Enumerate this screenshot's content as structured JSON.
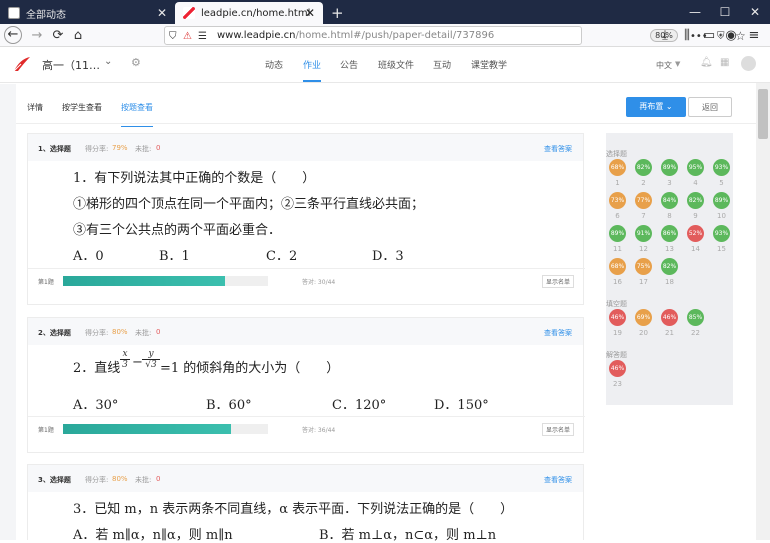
{
  "browser": {
    "tabs": [
      {
        "label": "全部动态",
        "active": false
      },
      {
        "label": "leadpie.cn/home.html#/push",
        "active": true
      }
    ],
    "new_tab": "+",
    "url_domain": "www.leadpie.cn",
    "url_path": "/home.html#/push/paper-detail/737896",
    "zoom": "80%",
    "menu_dots": "•••"
  },
  "app": {
    "class_name": "高一（11…",
    "nav": [
      "动态",
      "作业",
      "公告",
      "班级文件",
      "互动",
      "课堂教学"
    ],
    "active_nav": 1,
    "lang": "中文"
  },
  "subtabs": [
    "详情",
    "按学生查看",
    "按题查看"
  ],
  "active_subtab": 2,
  "buttons": {
    "reassign": "再布置",
    "back": "返回"
  },
  "questions": [
    {
      "head": "1、选择题",
      "score_label": "得分率:",
      "score": "79%",
      "score_color": "#e8a04a",
      "unsub_label": "未批:",
      "unsub": "0",
      "answer_link": "查看答案",
      "lines": [
        "1．有下列说法其中正确的个数是（　　）",
        "①梯形的四个顶点在同一个平面内；②三条平行直线必共面；",
        "③有三个公共点的两个平面必重合．"
      ],
      "options": [
        "A．0",
        "B．1",
        "C．2",
        "D．3"
      ],
      "bar_label": "第1题",
      "progress": 0.79,
      "correct": "答对: 30/44",
      "show_names": "显示名单"
    },
    {
      "head": "2、选择题",
      "score_label": "得分率:",
      "score": "80%",
      "score_color": "#e8a04a",
      "unsub_label": "未批:",
      "unsub": "0",
      "answer_link": "查看答案",
      "lines": [
        "2．直线",
        "=1 的倾斜角的大小为（　　）"
      ],
      "frac1": {
        "num": "x",
        "den": "3"
      },
      "frac2": {
        "num": "y",
        "den": "√3"
      },
      "options": [
        "A．30°",
        "B．60°",
        "C．120°",
        "D．150°"
      ],
      "bar_label": "第1题",
      "progress": 0.82,
      "correct": "答对: 36/44",
      "show_names": "显示名单"
    },
    {
      "head": "3、选择题",
      "score_label": "得分率:",
      "score": "80%",
      "score_color": "#e8a04a",
      "unsub_label": "未批:",
      "unsub": "0",
      "answer_link": "查看答案",
      "lines": [
        "3．已知 m，n 表示两条不同直线，α 表示平面．下列说法正确的是（　　）"
      ],
      "options": [
        "A．若 m∥α，n∥α，则 m∥n",
        "B．若 m⊥α，n⊂α，则 m⊥n"
      ]
    }
  ],
  "sidebar": {
    "sections": [
      {
        "title": "选择题",
        "items": [
          {
            "n": "1",
            "p": "68%",
            "c": "#e8a04a"
          },
          {
            "n": "2",
            "p": "82%",
            "c": "#5cb85c"
          },
          {
            "n": "3",
            "p": "89%",
            "c": "#5cb85c"
          },
          {
            "n": "4",
            "p": "95%",
            "c": "#5cb85c"
          },
          {
            "n": "5",
            "p": "93%",
            "c": "#5cb85c"
          },
          {
            "n": "6",
            "p": "73%",
            "c": "#e8a04a"
          },
          {
            "n": "7",
            "p": "77%",
            "c": "#e8a04a"
          },
          {
            "n": "8",
            "p": "84%",
            "c": "#5cb85c"
          },
          {
            "n": "9",
            "p": "82%",
            "c": "#5cb85c"
          },
          {
            "n": "10",
            "p": "89%",
            "c": "#5cb85c"
          },
          {
            "n": "11",
            "p": "89%",
            "c": "#5cb85c"
          },
          {
            "n": "12",
            "p": "91%",
            "c": "#5cb85c"
          },
          {
            "n": "13",
            "p": "86%",
            "c": "#5cb85c"
          },
          {
            "n": "14",
            "p": "52%",
            "c": "#e25c5c"
          },
          {
            "n": "15",
            "p": "93%",
            "c": "#5cb85c"
          },
          {
            "n": "16",
            "p": "68%",
            "c": "#e8a04a"
          },
          {
            "n": "17",
            "p": "75%",
            "c": "#e8a04a"
          },
          {
            "n": "18",
            "p": "82%",
            "c": "#5cb85c"
          }
        ]
      },
      {
        "title": "填空题",
        "items": [
          {
            "n": "19",
            "p": "46%",
            "c": "#e25c5c"
          },
          {
            "n": "20",
            "p": "69%",
            "c": "#e8a04a"
          },
          {
            "n": "21",
            "p": "46%",
            "c": "#e25c5c"
          },
          {
            "n": "22",
            "p": "85%",
            "c": "#5cb85c"
          }
        ]
      },
      {
        "title": "解答题",
        "items": [
          {
            "n": "23",
            "p": "46%",
            "c": "#e25c5c"
          }
        ]
      }
    ]
  }
}
